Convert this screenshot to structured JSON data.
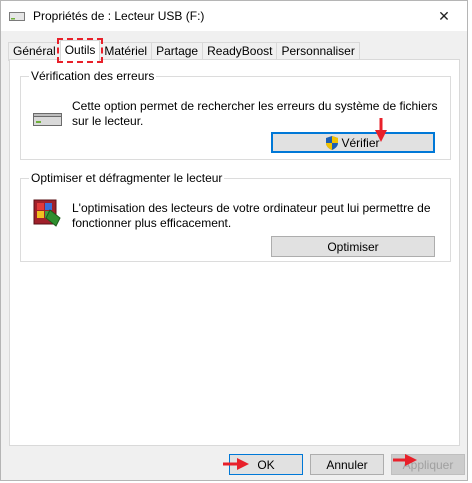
{
  "window": {
    "title": "Propriétés de : Lecteur USB (F:)",
    "close_glyph": "✕"
  },
  "tabs": [
    {
      "label": "Général"
    },
    {
      "label": "Outils",
      "active": true
    },
    {
      "label": "Matériel"
    },
    {
      "label": "Partage"
    },
    {
      "label": "ReadyBoost"
    },
    {
      "label": "Personnaliser"
    }
  ],
  "error_check": {
    "title": "Vérification des erreurs",
    "description": "Cette option permet de rechercher les erreurs du système de fichiers sur le lecteur.",
    "button": "Vérifier"
  },
  "optimize": {
    "title": "Optimiser et défragmenter le lecteur",
    "description": "L'optimisation des lecteurs de votre ordinateur peut lui permettre de fonctionner plus efficacement.",
    "button": "Optimiser"
  },
  "footer": {
    "ok": "OK",
    "cancel": "Annuler",
    "apply": "Appliquer"
  },
  "colors": {
    "annotation": "#e8202a",
    "focus": "#0078d7"
  }
}
